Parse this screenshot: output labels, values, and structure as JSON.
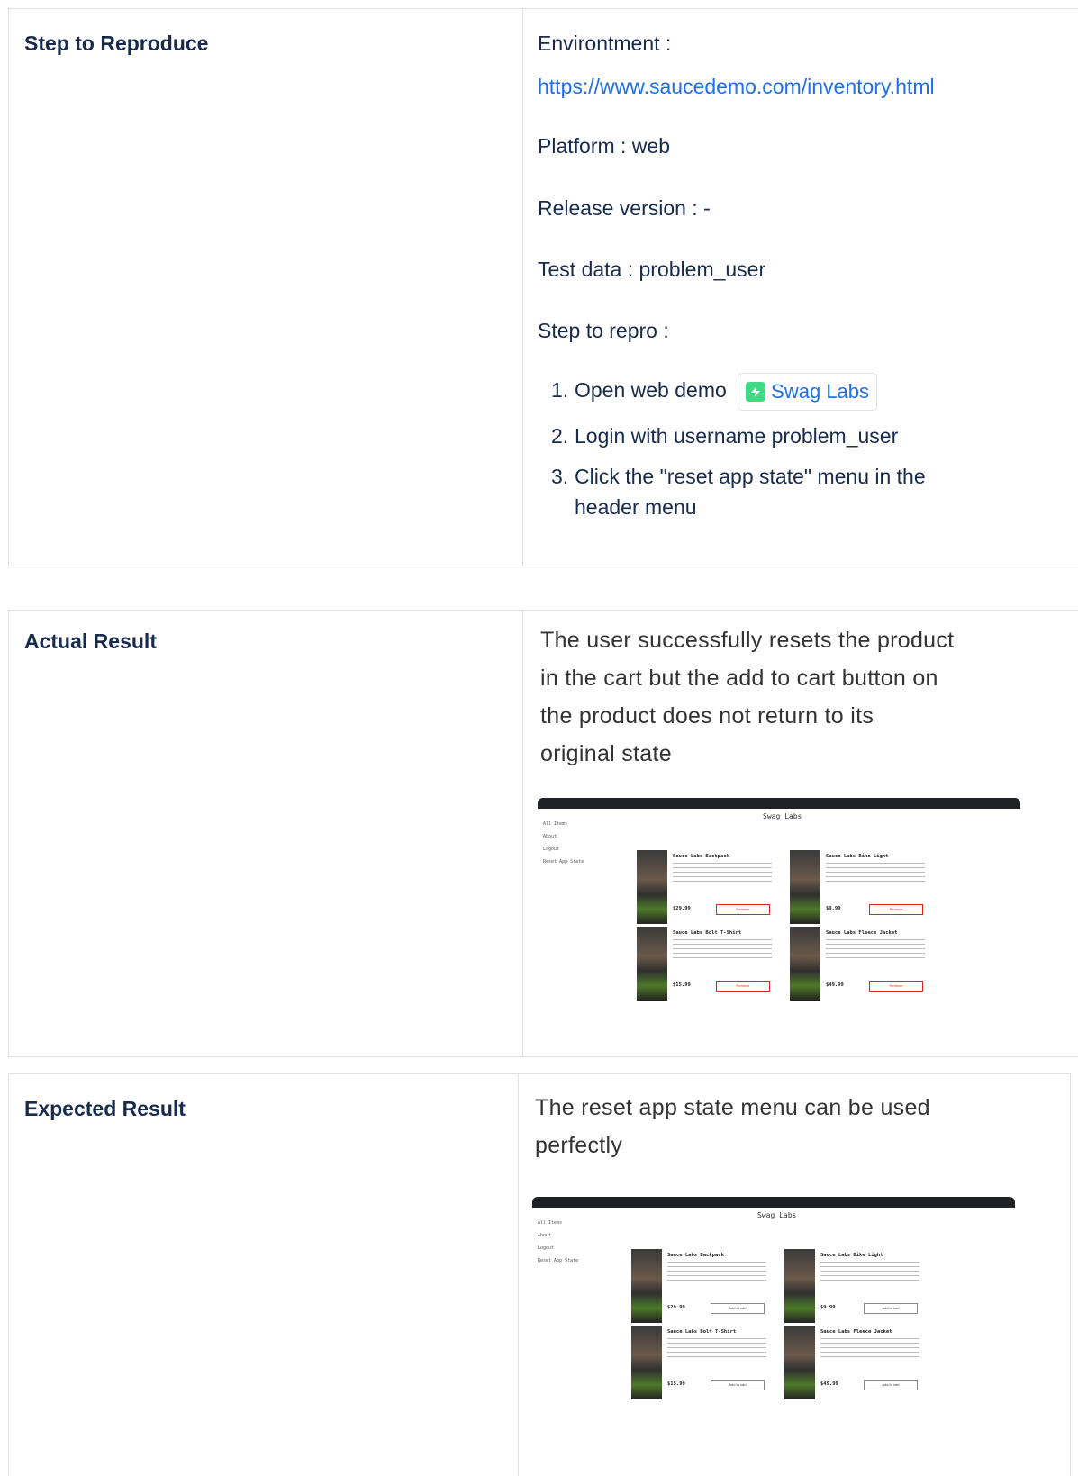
{
  "step_section": {
    "label": "Step to Reproduce",
    "environment_label": "Environtment :",
    "environment_url": "https://www.saucedemo.com/inventory.html",
    "platform": "Platform : web",
    "release": "Release version : -",
    "test_data": "Test data : problem_user",
    "repro_heading": "Step to repro :",
    "steps": [
      {
        "num": "1.",
        "text": "Open web demo",
        "link_label": "Swag Labs"
      },
      {
        "num": "2.",
        "text": "Login with username problem_user"
      },
      {
        "num": "3.",
        "text_line1": "Click the \"reset app state\" menu in the",
        "text_line2": "header menu"
      }
    ]
  },
  "actual_section": {
    "label": "Actual Result",
    "lines": [
      "The user successfully resets the product",
      "in the cart but the add to cart button on",
      "the product does not return to its",
      "original state"
    ]
  },
  "expected_section": {
    "label": "Expected Result",
    "lines": [
      "The reset app state menu can be used",
      "perfectly"
    ]
  },
  "screenshot": {
    "app_title": "Swag Labs",
    "menu": [
      "All Items",
      "About",
      "Logout",
      "Reset App State"
    ],
    "products": [
      {
        "name": "Sauce Labs Backpack",
        "price": "$29.99"
      },
      {
        "name": "Sauce Labs Bike Light",
        "price": "$9.99"
      },
      {
        "name": "Sauce Labs Bolt T-Shirt",
        "price": "$15.99"
      },
      {
        "name": "Sauce Labs Fleece Jacket",
        "price": "$49.99"
      }
    ],
    "actual_button": "Remove",
    "expected_button": "Add to cart"
  },
  "colors": {
    "link": "#1f6feb",
    "border": "#dfe1e6",
    "remove": "#e2231a"
  }
}
